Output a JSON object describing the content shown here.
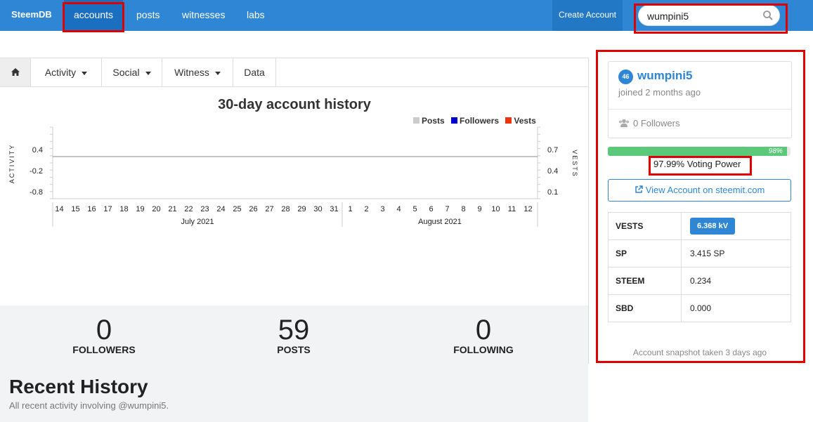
{
  "navbar": {
    "brand": "SteemDB",
    "links": [
      "accounts",
      "posts",
      "witnesses",
      "labs"
    ],
    "create_account": "Create Account",
    "search_value": "wumpini5",
    "search_icon": "search-icon"
  },
  "subnav": {
    "home_icon": "home-icon",
    "tabs": [
      "Activity",
      "Social",
      "Witness",
      "Data"
    ]
  },
  "chart_data": {
    "type": "line",
    "title": "30-day account history",
    "legend": [
      "Posts",
      "Followers",
      "Vests"
    ],
    "legend_colors": [
      "#cccccc",
      "#0000cc",
      "#ee3311"
    ],
    "legend_placement": "top-right",
    "ylabel_left": "ACTIVITY",
    "ylabel_right": "VESTS",
    "left_ticks": [
      "0.4",
      "-0.2",
      "-0.8"
    ],
    "right_ticks": [
      "0.7",
      "0.4",
      "0.1"
    ],
    "x_ticks": [
      "14",
      "15",
      "16",
      "17",
      "18",
      "19",
      "20",
      "21",
      "22",
      "23",
      "24",
      "25",
      "26",
      "27",
      "28",
      "29",
      "30",
      "31",
      "1",
      "2",
      "3",
      "4",
      "5",
      "6",
      "7",
      "8",
      "9",
      "10",
      "11",
      "12"
    ],
    "x_groups": [
      "July 2021",
      "August 2021"
    ],
    "series": [
      {
        "name": "Posts",
        "values": [
          0,
          0,
          0,
          0,
          0,
          0,
          0,
          0,
          0,
          0,
          0,
          0,
          0,
          0,
          0,
          0,
          0,
          0,
          0,
          0,
          0,
          0,
          0,
          0,
          0,
          0,
          0,
          0,
          0,
          0
        ]
      }
    ]
  },
  "stats": [
    {
      "value": "0",
      "label": "FOLLOWERS"
    },
    {
      "value": "59",
      "label": "POSTS"
    },
    {
      "value": "0",
      "label": "FOLLOWING"
    }
  ],
  "recent": {
    "title": "Recent History",
    "subtitle": "All recent activity involving @wumpini5."
  },
  "profile": {
    "reputation": "46",
    "name": "wumpini5",
    "joined": "joined 2 months ago",
    "followers": "0 Followers",
    "voting_power_bar": "98%",
    "voting_power_fraction": 0.98,
    "voting_power_text": "97.99% Voting Power",
    "view_account": "View Account on steemit.com"
  },
  "balances": [
    {
      "key": "VESTS",
      "value": "6.368 kV"
    },
    {
      "key": "SP",
      "value": "3.415 SP"
    },
    {
      "key": "STEEM",
      "value": "0.234"
    },
    {
      "key": "SBD",
      "value": "0.000"
    }
  ],
  "snapshot": "Account snapshot taken 3 days ago"
}
